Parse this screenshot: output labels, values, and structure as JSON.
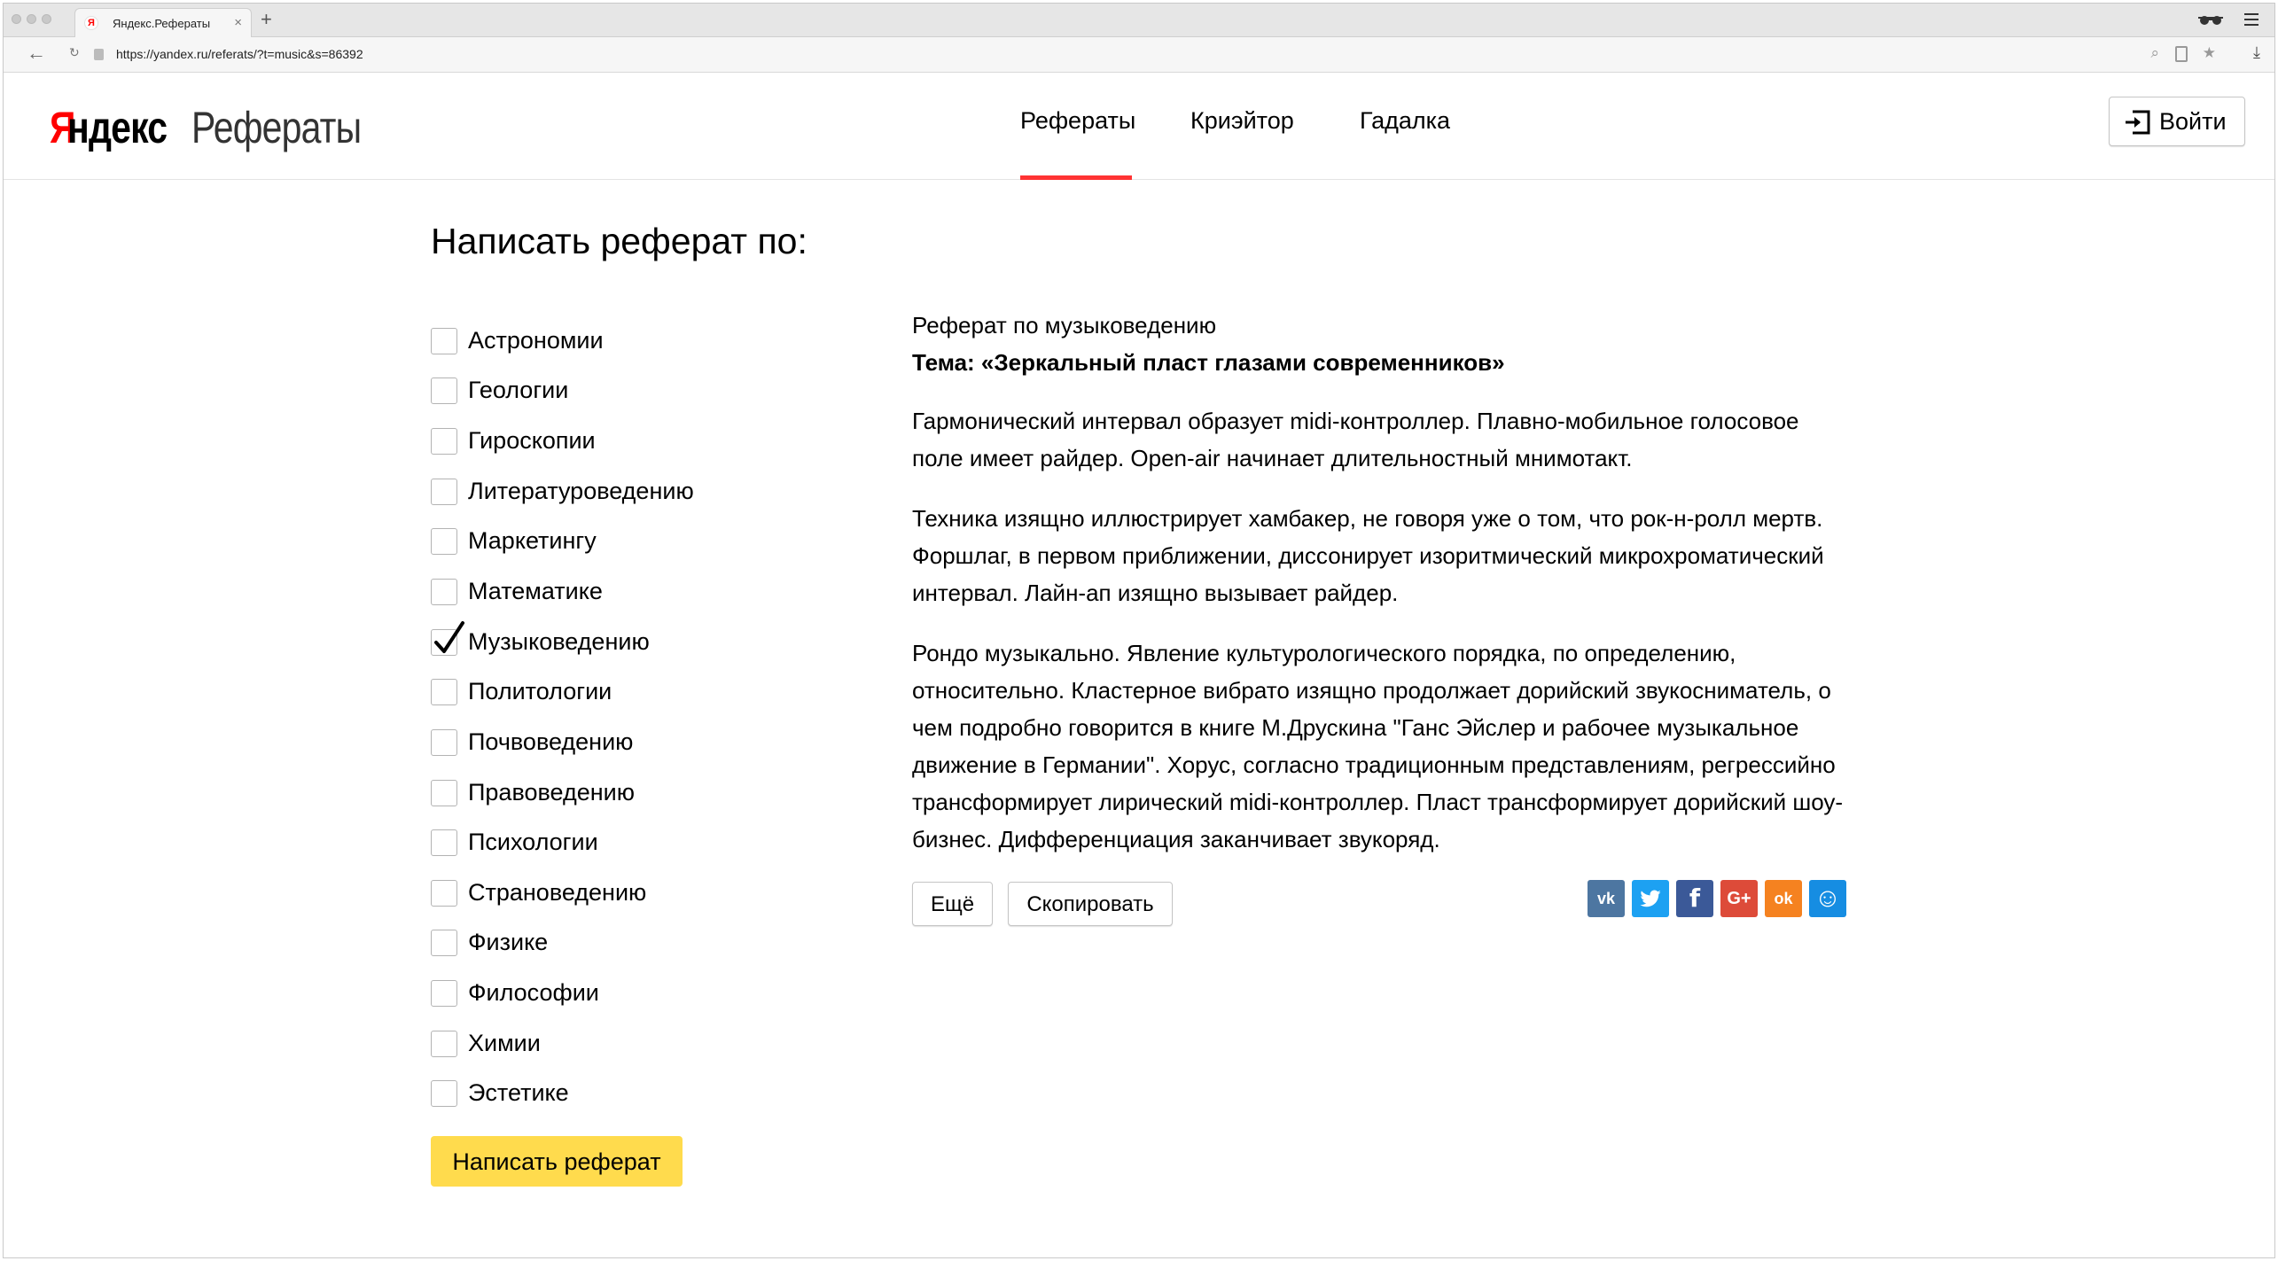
{
  "browser": {
    "tab_title": "Яндекс.Рефераты",
    "tab_close": "×",
    "new_tab": "+",
    "url": "https://yandex.ru/referats/?t=music&s=86392",
    "back": "←",
    "reload": "↻",
    "download": "⤓"
  },
  "header": {
    "logo_ya": "Я",
    "logo_ndex": "ндекс",
    "logo_service": "Рефераты",
    "nav": [
      {
        "label": "Рефераты",
        "active": true
      },
      {
        "label": "Криэйтор",
        "active": false
      },
      {
        "label": "Гадалка",
        "active": false
      }
    ],
    "login_label": "Войти"
  },
  "sidebar": {
    "title": "Написать реферат по:",
    "subjects": [
      {
        "label": "Астрономии",
        "checked": false
      },
      {
        "label": "Геологии",
        "checked": false
      },
      {
        "label": "Гироскопии",
        "checked": false
      },
      {
        "label": "Литературоведению",
        "checked": false
      },
      {
        "label": "Маркетингу",
        "checked": false
      },
      {
        "label": "Математике",
        "checked": false
      },
      {
        "label": "Музыковедению",
        "checked": true
      },
      {
        "label": "Политологии",
        "checked": false
      },
      {
        "label": "Почвоведению",
        "checked": false
      },
      {
        "label": "Правоведению",
        "checked": false
      },
      {
        "label": "Психологии",
        "checked": false
      },
      {
        "label": "Страноведению",
        "checked": false
      },
      {
        "label": "Физике",
        "checked": false
      },
      {
        "label": "Философии",
        "checked": false
      },
      {
        "label": "Химии",
        "checked": false
      },
      {
        "label": "Эстетике",
        "checked": false
      }
    ],
    "submit_label": "Написать реферат"
  },
  "essay": {
    "subject_line": "Реферат по музыковедению",
    "topic": "Тема: «Зеркальный пласт глазами современников»",
    "paragraphs": [
      "Гармонический интервал образует midi-контроллер. Плавно-мобильное голосовое поле имеет райдер. Open-air начинает длительностный мнимотакт.",
      "Техника изящно иллюстрирует хамбакер, не говоря уже о том, что рок-н-ролл мертв. Форшлаг, в первом приближении, диссонирует изоритмический микрохроматический интервал. Лайн-ап изящно вызывает райдер.",
      "Рондо музыкально. Явление культурологического порядка, по определению, относительно. Кластерное вибрато изящно продолжает дорийский звукосниматель, о чем подробно говорится в книге М.Друскина \"Ганс Эйслер и рабочее музыкальное движение в Германии\". Хорус, согласно традиционным представлениям, регрессийно трансформирует лирический midi-контроллер. Пласт трансформирует дорийский шоу-бизнес. Дифференциация заканчивает звукоряд."
    ],
    "more_label": "Ещё",
    "copy_label": "Скопировать"
  },
  "share": [
    {
      "icon": "vk-icon",
      "glyph": "vk",
      "color": "#4d76a1"
    },
    {
      "icon": "twitter-icon",
      "glyph": "🐦",
      "color": "#1da1f2"
    },
    {
      "icon": "facebook-icon",
      "glyph": "f",
      "color": "#3b5998"
    },
    {
      "icon": "google-plus-icon",
      "glyph": "G+",
      "color": "#dd4b39"
    },
    {
      "icon": "odnoklassniki-icon",
      "glyph": "ok",
      "color": "#f58220"
    },
    {
      "icon": "moimir-icon",
      "glyph": "☺",
      "color": "#168de2"
    }
  ],
  "colors": {
    "accent_red": "#ff3333",
    "submit_yellow": "#ffdb4d"
  }
}
